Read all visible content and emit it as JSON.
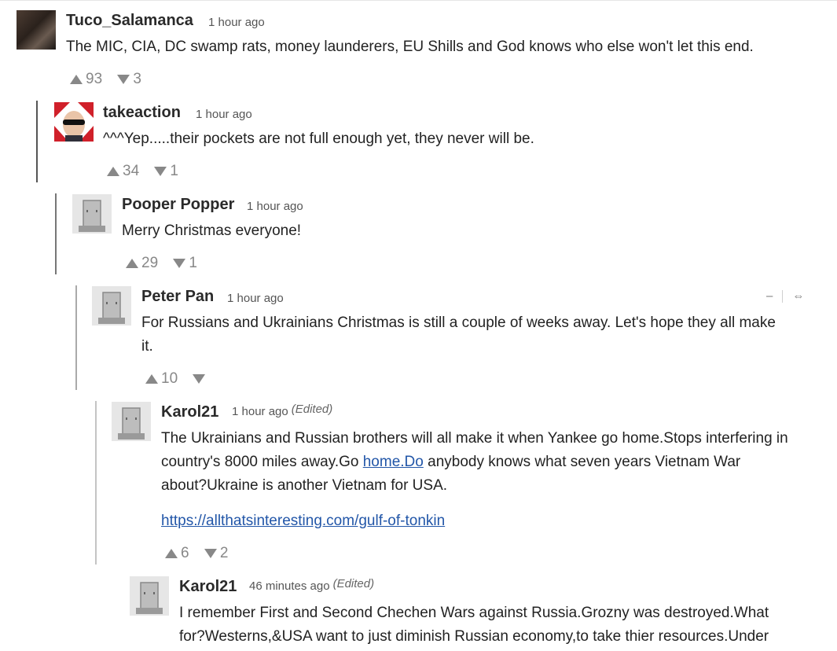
{
  "comments": [
    {
      "author": "Tuco_Salamanca",
      "time": "1 hour ago",
      "edited": "",
      "lines": [
        "The MIC, CIA, DC swamp rats, money launderers, EU Shills and God knows who else won't let this end."
      ],
      "upvotes": "93",
      "downvotes": "3"
    },
    {
      "author": "takeaction",
      "time": "1 hour ago",
      "edited": "",
      "lines": [
        "^^^Yep.....their pockets are not full enough yet, they never will be."
      ],
      "upvotes": "34",
      "downvotes": "1"
    },
    {
      "author": "Pooper Popper",
      "time": "1 hour ago",
      "edited": "",
      "lines": [
        "Merry Christmas  everyone!"
      ],
      "upvotes": "29",
      "downvotes": "1"
    },
    {
      "author": "Peter Pan",
      "time": "1 hour ago",
      "edited": "",
      "lines": [
        "For Russians and Ukrainians Christmas is still a couple of weeks away. Let's hope they all make",
        "it."
      ],
      "upvotes": "10",
      "downvotes": "",
      "actions": {
        "collapse": "–",
        "link": "⇔"
      }
    },
    {
      "author": "Karol21",
      "time": "1 hour ago",
      "edited": "(Edited)",
      "line1": "The Ukrainians and Russian brothers will all make it when Yankee go home.Stops interfering in",
      "line2_before": "country's 8000 miles away.Go ",
      "line2_link": "home.Do",
      "line2_after": " anybody knows what  seven years Vietnam  War",
      "line3": "about?Ukraine is another Vietnam for USA.",
      "url": "https://allthatsinteresting.com/gulf-of-tonkin",
      "upvotes": "6",
      "downvotes": "2"
    },
    {
      "author": "Karol21",
      "time": "46 minutes ago",
      "edited": "(Edited)",
      "lines": [
        "I remember First and Second Chechen Wars against Russia.Grozny was destroyed.What",
        "for?Westerns,&USA want to just diminish Russian economy,to take thier resources.Under"
      ]
    }
  ],
  "colors": {
    "thread_line": "#555555",
    "link": "#2256a8",
    "vote": "#888888"
  }
}
